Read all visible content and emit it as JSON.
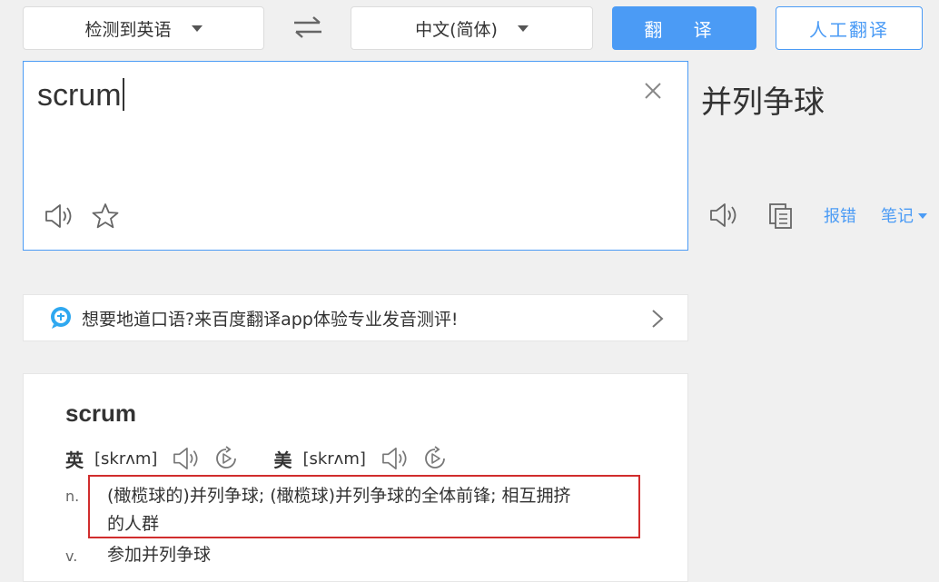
{
  "toolbar": {
    "source_lang": "检测到英语",
    "target_lang": "中文(简体)",
    "translate_label": "翻 译",
    "human_translate_label": "人工翻译"
  },
  "input": {
    "text": "scrum"
  },
  "output": {
    "text": "并列争球",
    "report_label": "报错",
    "notes_label": "笔记"
  },
  "banner": {
    "text": "想要地道口语?来百度翻译app体验专业发音测评!"
  },
  "dictionary": {
    "word": "scrum",
    "uk_label": "英",
    "uk_phonetic": "[skrʌm]",
    "us_label": "美",
    "us_phonetic": "[skrʌm]",
    "definitions": [
      {
        "pos": "n.",
        "line1": "(橄榄球的)并列争球; (橄榄球)并列争球的全体前锋; 相互拥挤",
        "line2": "的人群"
      },
      {
        "pos": "v.",
        "line1": "参加并列争球"
      }
    ]
  },
  "colors": {
    "accent": "#4b9bf5",
    "highlight": "#d12d2d",
    "background": "#f0f0f0"
  }
}
